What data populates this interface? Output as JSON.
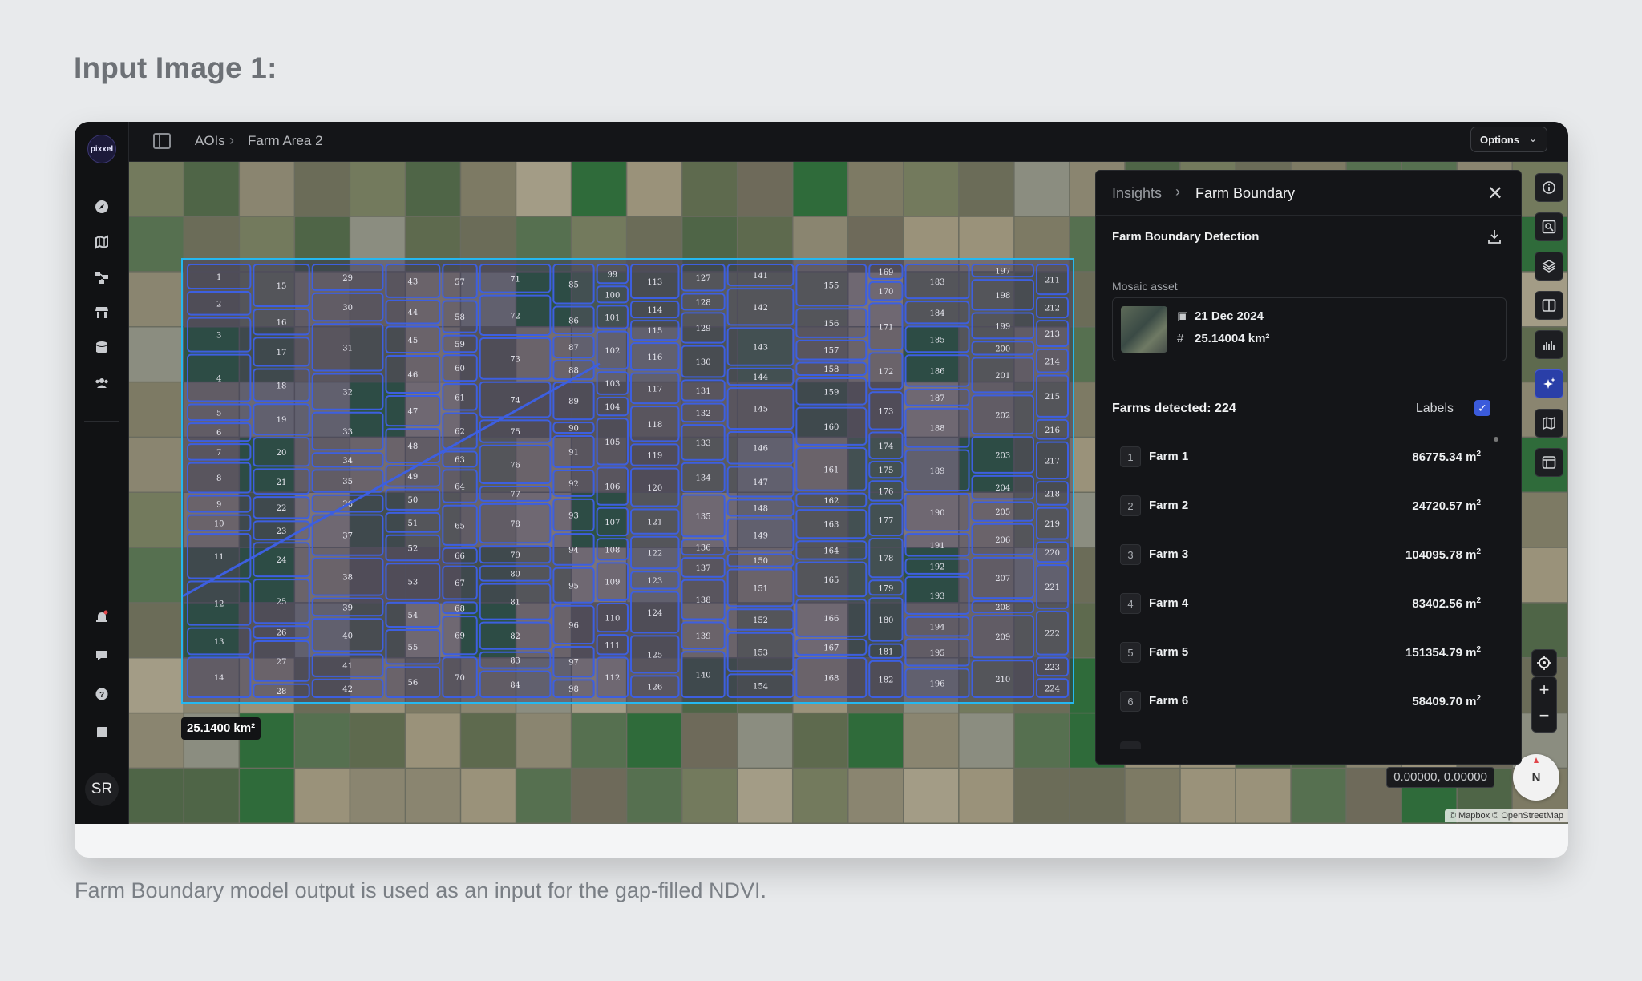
{
  "heading": "Input Image 1:",
  "caption": "Farm Boundary model output is used as an input for the gap-filled NDVI.",
  "app": {
    "logo_text": "pixxel",
    "avatar_initials": "SR"
  },
  "rail": {
    "icons": [
      "compass-icon",
      "map-icon",
      "workflow-icon",
      "store-icon",
      "database-icon",
      "team-icon"
    ],
    "bottom_icons": [
      "bell-icon",
      "chat-icon",
      "help-icon",
      "book-icon"
    ]
  },
  "topbar": {
    "breadcrumb": [
      "AOIs",
      "Farm Area 2"
    ],
    "options_label": "Options"
  },
  "map": {
    "area_badge": "25.1400 km²",
    "coordinates": "0.00000, 0.00000",
    "compass_label": "N",
    "attribution": "© Mapbox © OpenStreetMap",
    "zoom_in": "+",
    "zoom_out": "−",
    "aoi_color": "#25b8f0",
    "boundary_color": "#3d5fe0"
  },
  "tools": [
    "info-icon",
    "image-search-icon",
    "layers-icon",
    "split-view-icon",
    "chart-icon",
    "ai-sparkle-icon",
    "map-book-icon",
    "layout-icon"
  ],
  "panel": {
    "breadcrumb_parent": "Insights",
    "breadcrumb_current": "Farm Boundary",
    "section_title": "Farm Boundary Detection",
    "mosaic_label": "Mosaic asset",
    "mosaic_date": "21 Dec 2024",
    "mosaic_area": "25.14004 km²",
    "farms_detected": "Farms detected: 224",
    "labels_text": "Labels",
    "labels_checked": true,
    "farms": [
      {
        "num": "1",
        "name": "Farm 1",
        "area": "86775.34 m",
        "unit_sup": "2"
      },
      {
        "num": "2",
        "name": "Farm 2",
        "area": "24720.57 m",
        "unit_sup": "2"
      },
      {
        "num": "3",
        "name": "Farm 3",
        "area": "104095.78 m",
        "unit_sup": "2"
      },
      {
        "num": "4",
        "name": "Farm 4",
        "area": "83402.56 m",
        "unit_sup": "2"
      },
      {
        "num": "5",
        "name": "Farm 5",
        "area": "151354.79 m",
        "unit_sup": "2"
      },
      {
        "num": "6",
        "name": "Farm 6",
        "area": "58409.70 m",
        "unit_sup": "2"
      }
    ]
  },
  "map_labels": [
    "1",
    "2",
    "3",
    "4",
    "5",
    "6",
    "7",
    "8",
    "9",
    "10",
    "11",
    "12",
    "13",
    "14",
    "15",
    "16",
    "17",
    "18",
    "19",
    "20",
    "21",
    "22",
    "23",
    "24",
    "25",
    "26",
    "27",
    "28",
    "29",
    "30",
    "31",
    "32",
    "33",
    "34",
    "35",
    "36",
    "37",
    "38",
    "39",
    "40",
    "41",
    "42",
    "43",
    "44",
    "45",
    "46",
    "47",
    "48",
    "49",
    "50",
    "51",
    "52",
    "53",
    "54",
    "55",
    "56",
    "57",
    "58",
    "59",
    "60",
    "61",
    "62",
    "63",
    "64",
    "65",
    "66",
    "67",
    "68",
    "69",
    "70",
    "71",
    "72",
    "73",
    "74",
    "75",
    "76",
    "77",
    "78",
    "79",
    "80",
    "81",
    "82",
    "83",
    "84",
    "85",
    "86",
    "87",
    "88",
    "89",
    "90",
    "91",
    "92",
    "93",
    "94",
    "95",
    "96",
    "97",
    "98",
    "99",
    "100",
    "101",
    "102",
    "103",
    "104",
    "105",
    "106",
    "107",
    "108",
    "109",
    "110",
    "111",
    "112",
    "113",
    "114",
    "115",
    "116",
    "117",
    "118",
    "119",
    "120",
    "121",
    "122",
    "123",
    "124",
    "125",
    "126",
    "127",
    "128",
    "129",
    "130",
    "131",
    "132",
    "133",
    "134",
    "135",
    "136",
    "137",
    "138",
    "139",
    "140",
    "141",
    "142",
    "143",
    "144",
    "145",
    "146",
    "147",
    "148",
    "149",
    "150",
    "151",
    "152",
    "153",
    "154",
    "155",
    "156",
    "157",
    "158",
    "159",
    "160",
    "161",
    "162",
    "163",
    "164",
    "165",
    "166",
    "167",
    "168",
    "169",
    "170",
    "171",
    "172",
    "173",
    "174",
    "175",
    "176",
    "177",
    "178",
    "179",
    "180",
    "181",
    "182",
    "183",
    "184",
    "185",
    "186",
    "187",
    "188",
    "189",
    "190",
    "191",
    "192",
    "193",
    "194",
    "195",
    "196",
    "197",
    "198",
    "199",
    "200",
    "201",
    "202",
    "203",
    "204",
    "205",
    "206",
    "207",
    "208",
    "209",
    "210",
    "211",
    "212",
    "213",
    "214",
    "215",
    "216",
    "217",
    "218",
    "219",
    "220",
    "221",
    "222",
    "223",
    "224"
  ]
}
